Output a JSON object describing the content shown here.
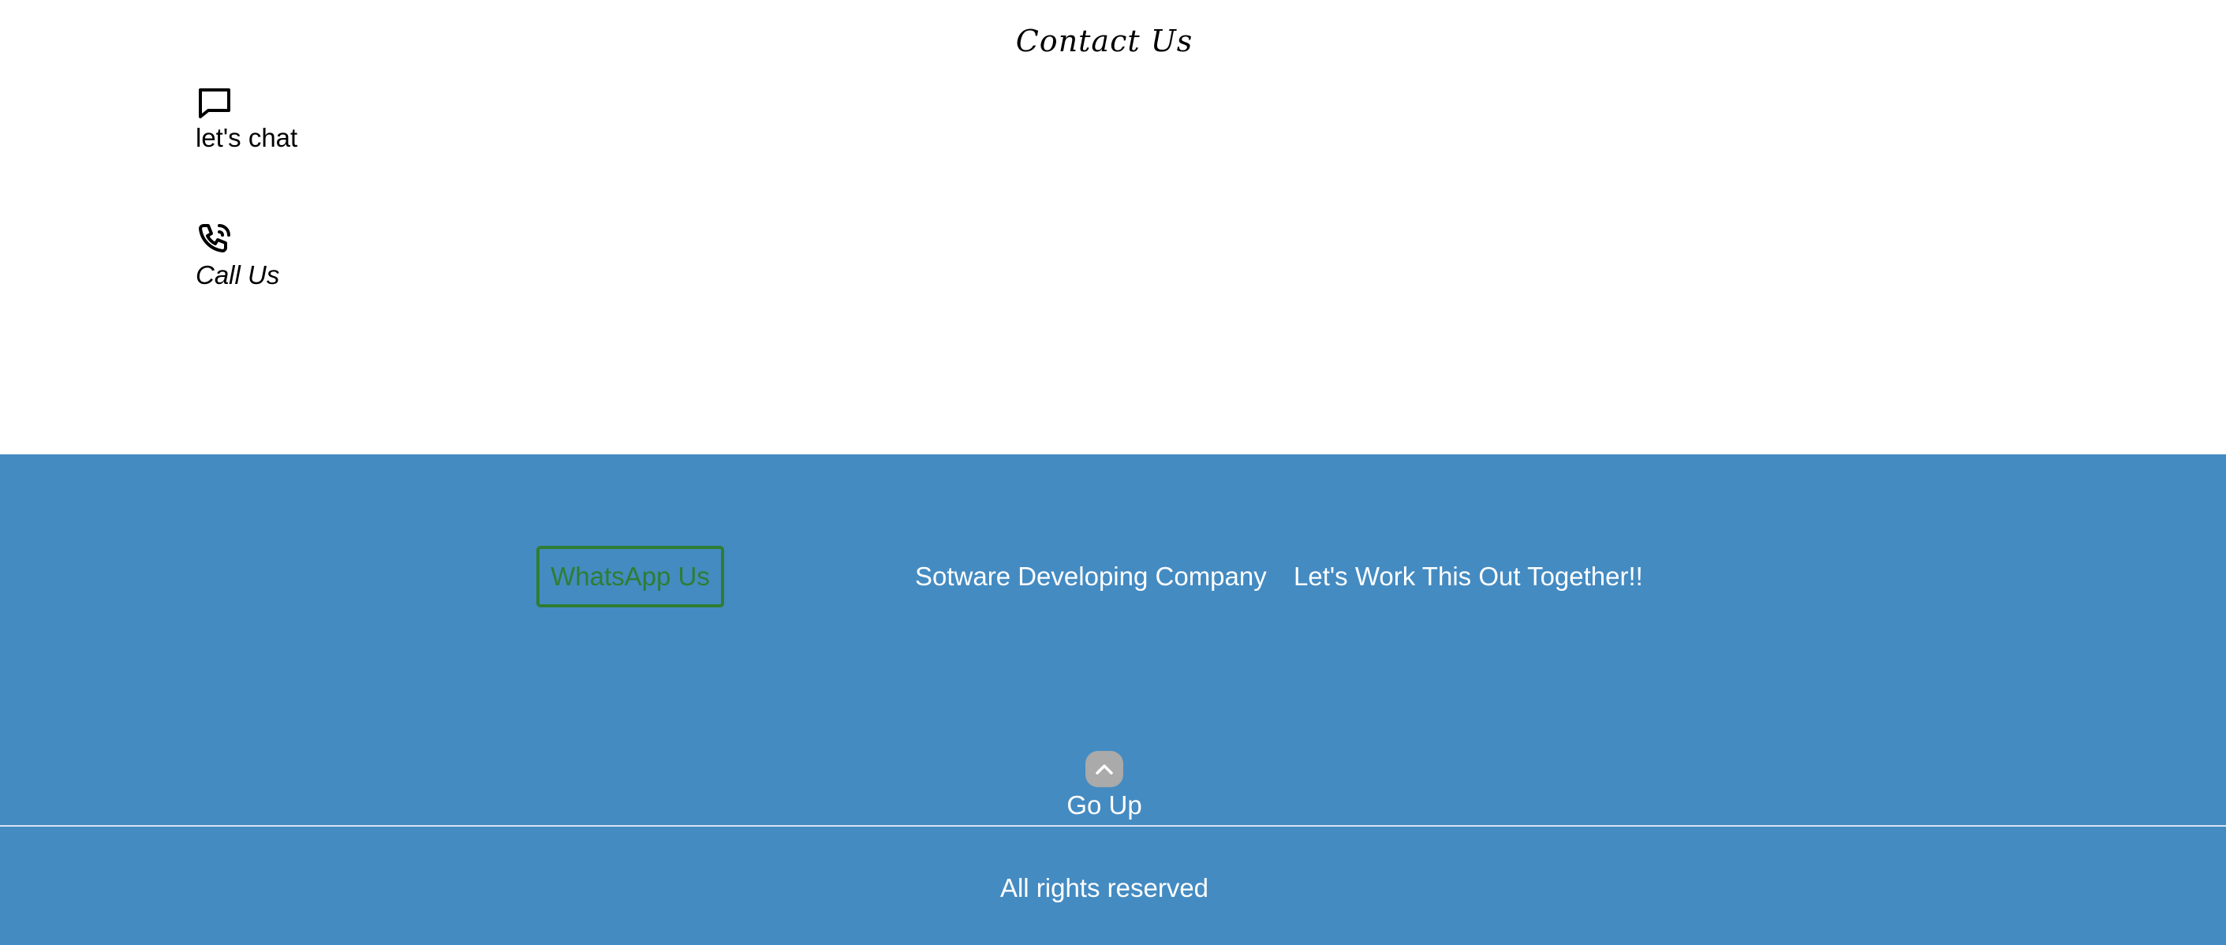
{
  "contact": {
    "title": "Contact Us",
    "items": [
      {
        "icon": "chat-bubble-icon",
        "label": "let's chat"
      },
      {
        "icon": "phone-call-icon",
        "label": "Call Us"
      }
    ]
  },
  "footer": {
    "whatsapp_button": "WhatsApp Us",
    "company": "Sotware Developing Company",
    "tagline": "Let's Work This Out Together!!",
    "go_up": {
      "icon": "chevron-up-icon",
      "label": "Go Up"
    },
    "copyright": "All rights reserved"
  },
  "colors": {
    "footer_background": "#448bc2",
    "whatsapp_accent": "#2e7d32",
    "go_up_circle": "#a9aaa9",
    "text_light": "#ffffff"
  }
}
